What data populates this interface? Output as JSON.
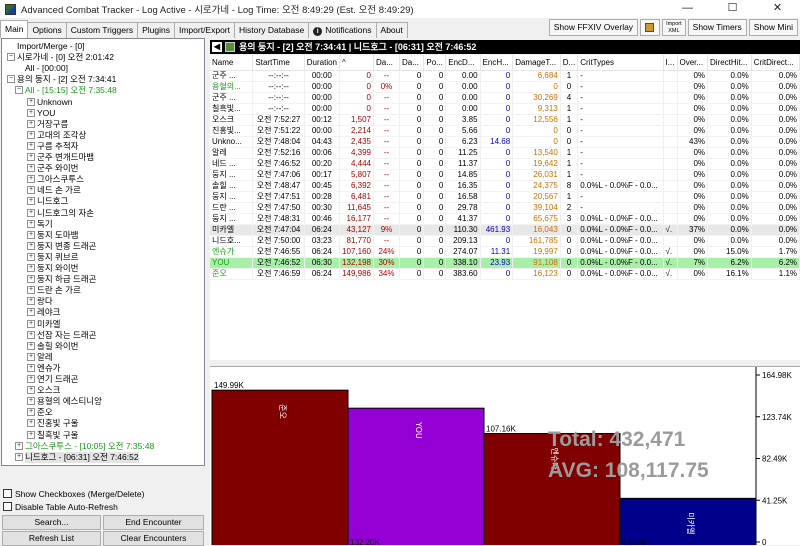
{
  "window": {
    "title": "Advanced Combat Tracker - Log Active - 시로가네 - Log Time: 오전 8:49:29 (Est. 오전 8:49:29)",
    "minimize": "—",
    "maximize": "☐",
    "close": "✕"
  },
  "tabs": [
    "Main",
    "Options",
    "Custom Triggers",
    "Plugins",
    "Import/Export",
    "History Database",
    "Notifications",
    "About"
  ],
  "toolbar": {
    "ffxiv_overlay": "Show FFXIV Overlay",
    "import_xml_line1": "Import",
    "import_xml_line2": "XML",
    "show_timers": "Show Timers",
    "show_mini": "Show Mini"
  },
  "tree": [
    {
      "label": "Import/Merge - [0]",
      "depth": 0,
      "exp": "",
      "color": "default"
    },
    {
      "label": "시로가네 - [0] 오전 2:01:42",
      "depth": 0,
      "exp": "−",
      "color": "default"
    },
    {
      "label": "All - [00:00]",
      "depth": 1,
      "exp": "",
      "color": "default"
    },
    {
      "label": "용의 둥지 - [2] 오전 7:34:41",
      "depth": 0,
      "exp": "−",
      "color": "default"
    },
    {
      "label": "All - [15:15] 오전 7:35:48",
      "depth": 1,
      "exp": "−",
      "color": "green"
    },
    {
      "label": "Unknown",
      "depth": 2,
      "exp": "+",
      "color": "default"
    },
    {
      "label": "YOU",
      "depth": 2,
      "exp": "+",
      "color": "default"
    },
    {
      "label": "거장구름",
      "depth": 2,
      "exp": "+",
      "color": "default"
    },
    {
      "label": "고대의 조각상",
      "depth": 2,
      "exp": "+",
      "color": "default"
    },
    {
      "label": "구름 추적자",
      "depth": 2,
      "exp": "+",
      "color": "default"
    },
    {
      "label": "군주 변개드마뱀",
      "depth": 2,
      "exp": "+",
      "color": "default"
    },
    {
      "label": "군주 와이번",
      "depth": 2,
      "exp": "+",
      "color": "default"
    },
    {
      "label": "그아스쿠투스",
      "depth": 2,
      "exp": "+",
      "color": "default"
    },
    {
      "label": "네드 손 가르",
      "depth": 2,
      "exp": "+",
      "color": "default"
    },
    {
      "label": "니드호그",
      "depth": 2,
      "exp": "+",
      "color": "default"
    },
    {
      "label": "니드호그의 자손",
      "depth": 2,
      "exp": "+",
      "color": "default"
    },
    {
      "label": "독기",
      "depth": 2,
      "exp": "+",
      "color": "default"
    },
    {
      "label": "둥지 도마뱀",
      "depth": 2,
      "exp": "+",
      "color": "default"
    },
    {
      "label": "둥지 변종 드래곤",
      "depth": 2,
      "exp": "+",
      "color": "default"
    },
    {
      "label": "둥지 퀴브르",
      "depth": 2,
      "exp": "+",
      "color": "default"
    },
    {
      "label": "둥지 와이번",
      "depth": 2,
      "exp": "+",
      "color": "default"
    },
    {
      "label": "둥지 하급 드래곤",
      "depth": 2,
      "exp": "+",
      "color": "default"
    },
    {
      "label": "드란 손 가르",
      "depth": 2,
      "exp": "+",
      "color": "default"
    },
    {
      "label": "랑다",
      "depth": 2,
      "exp": "+",
      "color": "default"
    },
    {
      "label": "레야크",
      "depth": 2,
      "exp": "+",
      "color": "default"
    },
    {
      "label": "미카엘",
      "depth": 2,
      "exp": "+",
      "color": "default"
    },
    {
      "label": "선잠 자는 드래곤",
      "depth": 2,
      "exp": "+",
      "color": "default"
    },
    {
      "label": "솔힐 와이번",
      "depth": 2,
      "exp": "+",
      "color": "default"
    },
    {
      "label": "알레",
      "depth": 2,
      "exp": "+",
      "color": "default"
    },
    {
      "label": "엔슈가",
      "depth": 2,
      "exp": "+",
      "color": "default"
    },
    {
      "label": "연기 드래곤",
      "depth": 2,
      "exp": "+",
      "color": "default"
    },
    {
      "label": "오스크",
      "depth": 2,
      "exp": "+",
      "color": "default"
    },
    {
      "label": "용혈의 에스티니앙",
      "depth": 2,
      "exp": "+",
      "color": "default"
    },
    {
      "label": "준오",
      "depth": 2,
      "exp": "+",
      "color": "default"
    },
    {
      "label": "진홍빛 구울",
      "depth": 2,
      "exp": "+",
      "color": "default"
    },
    {
      "label": "칠흑빛 구울",
      "depth": 2,
      "exp": "+",
      "color": "default"
    },
    {
      "label": "그아스쿠투스 - [10:05] 오전 7:35:48",
      "depth": 1,
      "exp": "+",
      "color": "green"
    },
    {
      "label": "니드호그 - [06:31] 오전 7:46:52",
      "depth": 1,
      "exp": "+",
      "color": "default",
      "selected": true
    }
  ],
  "left_controls": {
    "show_checkboxes": "Show Checkboxes (Merge/Delete)",
    "disable_refresh": "Disable Table Auto-Refresh",
    "search": "Search...",
    "end_encounter": "End Encounter",
    "refresh_list": "Refresh List",
    "clear_encounters": "Clear Encounters"
  },
  "encounter_header": "용의 둥지 - [2] 오전 7:34:41 | 니드호그 - [06:31] 오전 7:46:52",
  "table": {
    "columns": [
      "Name",
      "StartTime",
      "Duration",
      "^",
      "Da...",
      "Da...",
      "Po...",
      "EncD...",
      "EncH...",
      "DamageT...",
      "D...",
      "CritTypes",
      "I...",
      "Over...",
      "DirectHit...",
      "CritDirect..."
    ],
    "rows": [
      {
        "cells": [
          "군주 ...",
          "--:--:--",
          "00:00",
          "0",
          "--",
          "0",
          "0",
          "0.00",
          "0",
          "6,684",
          "1",
          "-",
          "",
          "0%",
          "0.0%",
          "0.0%"
        ],
        "style": ""
      },
      {
        "cells": [
          "용혈의...",
          "--:--:--",
          "00:00",
          "0",
          "0%",
          "0",
          "0",
          "0.00",
          "0",
          "0",
          "0",
          "-",
          "",
          "0%",
          "0.0%",
          "0.0%"
        ],
        "style": "",
        "name_color": "green"
      },
      {
        "cells": [
          "군주 ...",
          "--:--:--",
          "00:00",
          "0",
          "--",
          "0",
          "0",
          "0.00",
          "0",
          "30,269",
          "4",
          "-",
          "",
          "0%",
          "0.0%",
          "0.0%"
        ],
        "style": ""
      },
      {
        "cells": [
          "칠흑빛...",
          "--:--:--",
          "00:00",
          "0",
          "--",
          "0",
          "0",
          "0.00",
          "0",
          "9,313",
          "1",
          "-",
          "",
          "0%",
          "0.0%",
          "0.0%"
        ],
        "style": ""
      },
      {
        "cells": [
          "오스크",
          "오전 7:52:27",
          "00:12",
          "1,507",
          "--",
          "0",
          "0",
          "3.85",
          "0",
          "12,556",
          "1",
          "-",
          "",
          "0%",
          "0.0%",
          "0.0%"
        ],
        "style": ""
      },
      {
        "cells": [
          "진홍빛...",
          "오전 7:51:22",
          "00:00",
          "2,214",
          "--",
          "0",
          "0",
          "5.66",
          "0",
          "0",
          "0",
          "-",
          "",
          "0%",
          "0.0%",
          "0.0%"
        ],
        "style": ""
      },
      {
        "cells": [
          "Unkno...",
          "오전 7:48:04",
          "04:43",
          "2,435",
          "--",
          "0",
          "0",
          "6.23",
          "14.68",
          "0",
          "0",
          "-",
          "",
          "43%",
          "0.0%",
          "0.0%"
        ],
        "style": ""
      },
      {
        "cells": [
          "알레",
          "오전 7:52:16",
          "00:06",
          "4,399",
          "--",
          "0",
          "0",
          "11.25",
          "0",
          "13,540",
          "1",
          "-",
          "",
          "0%",
          "0.0%",
          "0.0%"
        ],
        "style": ""
      },
      {
        "cells": [
          "네드 ...",
          "오전 7:46:52",
          "00:20",
          "4,444",
          "--",
          "0",
          "0",
          "11.37",
          "0",
          "19,642",
          "1",
          "-",
          "",
          "0%",
          "0.0%",
          "0.0%"
        ],
        "style": ""
      },
      {
        "cells": [
          "둥지 ...",
          "오전 7:47:06",
          "00:17",
          "5,807",
          "--",
          "0",
          "0",
          "14.85",
          "0",
          "26,031",
          "1",
          "-",
          "",
          "0%",
          "0.0%",
          "0.0%"
        ],
        "style": ""
      },
      {
        "cells": [
          "솔힐 ...",
          "오전 7:48:47",
          "00:45",
          "6,392",
          "--",
          "0",
          "0",
          "16.35",
          "0",
          "24,375",
          "8",
          "0.0%L - 0.0%F - 0.0...",
          "",
          "0%",
          "0.0%",
          "0.0%"
        ],
        "style": ""
      },
      {
        "cells": [
          "둥지 ...",
          "오전 7:47:51",
          "00:28",
          "6,481",
          "--",
          "0",
          "0",
          "16.58",
          "0",
          "20,567",
          "1",
          "-",
          "",
          "0%",
          "0.0%",
          "0.0%"
        ],
        "style": ""
      },
      {
        "cells": [
          "드란 ...",
          "오전 7:47:50",
          "00:30",
          "11,645",
          "--",
          "0",
          "0",
          "29.78",
          "0",
          "39,104",
          "2",
          "-",
          "",
          "0%",
          "0.0%",
          "0.0%"
        ],
        "style": ""
      },
      {
        "cells": [
          "둥지 ...",
          "오전 7:48:31",
          "00:46",
          "16,177",
          "--",
          "0",
          "0",
          "41.37",
          "0",
          "65,675",
          "3",
          "0.0%L - 0.0%F - 0.0...",
          "",
          "0%",
          "0.0%",
          "0.0%"
        ],
        "style": ""
      },
      {
        "cells": [
          "미카엘",
          "오전 7:47:04",
          "06:24",
          "43,127",
          "9%",
          "0",
          "0",
          "110.30",
          "461.93",
          "16,043",
          "0",
          "0.0%L - 0.0%F - 0.0...",
          "√.",
          "37%",
          "0.0%",
          "0.0%"
        ],
        "style": "grey"
      },
      {
        "cells": [
          "니드호...",
          "오전 7:50:00",
          "03:23",
          "81,770",
          "--",
          "0",
          "0",
          "209.13",
          "0",
          "161,785",
          "0",
          "0.0%L - 0.0%F - 0.0...",
          "",
          "0%",
          "0.0%",
          "0.0%"
        ],
        "style": ""
      },
      {
        "cells": [
          "엔슈가",
          "오전 7:46:55",
          "06:24",
          "107,160",
          "24%",
          "0",
          "0",
          "274.07",
          "11.31",
          "19,997",
          "0",
          "0.0%L - 0.0%F - 0.0...",
          "√.",
          "0%",
          "15.0%",
          "1.7%"
        ],
        "style": "",
        "name_color": "green"
      },
      {
        "cells": [
          "YOU",
          "오전 7:46:52",
          "06:30",
          "132,198",
          "30%",
          "0",
          "0",
          "338.10",
          "23.93",
          "91,108",
          "0",
          "0.0%L - 0.0%F - 0.0...",
          "√.",
          "7%",
          "6.2%",
          "6.2%"
        ],
        "style": "green",
        "name_color": "green"
      },
      {
        "cells": [
          "준오",
          "오전 7:46:59",
          "06:24",
          "149,986",
          "34%",
          "0",
          "0",
          "383.60",
          "0",
          "16,123",
          "0",
          "0.0%L - 0.0%F - 0.0...",
          "√.",
          "0%",
          "16.1%",
          "1.1%"
        ],
        "style": "",
        "name_color": "green"
      }
    ]
  },
  "graph": {
    "watermark_total": "Total: 432,471",
    "watermark_avg": "AVG: 108,117.75",
    "y_ticks": [
      "164.98K",
      "123.74K",
      "82.49K",
      "41.25K",
      "0"
    ]
  },
  "chart_data": {
    "type": "bar",
    "categories": [
      "준오",
      "YOU",
      "엔슈가",
      "미카엘"
    ],
    "values": [
      149986,
      132198,
      107160,
      43127
    ],
    "value_labels": [
      "149.99K",
      "132.20K",
      "107.16K",
      "43.13K"
    ],
    "colors": [
      "#800000",
      "#9400d3",
      "#800000",
      "#00008b"
    ],
    "ylim": [
      0,
      164980
    ],
    "ytick_labels": [
      "164.98K",
      "123.74K",
      "82.49K",
      "41.25K",
      "0"
    ],
    "total_text": "Total: 432,471",
    "avg_text": "AVG: 108,117.75"
  },
  "colors": {
    "red_value": "#b00000",
    "blue_value": "#0000c0",
    "orange_value": "#d07000",
    "green_name": "#1a9a1a",
    "highlight_row": "#a8f0a8",
    "grey_row": "#e8e8e8"
  }
}
